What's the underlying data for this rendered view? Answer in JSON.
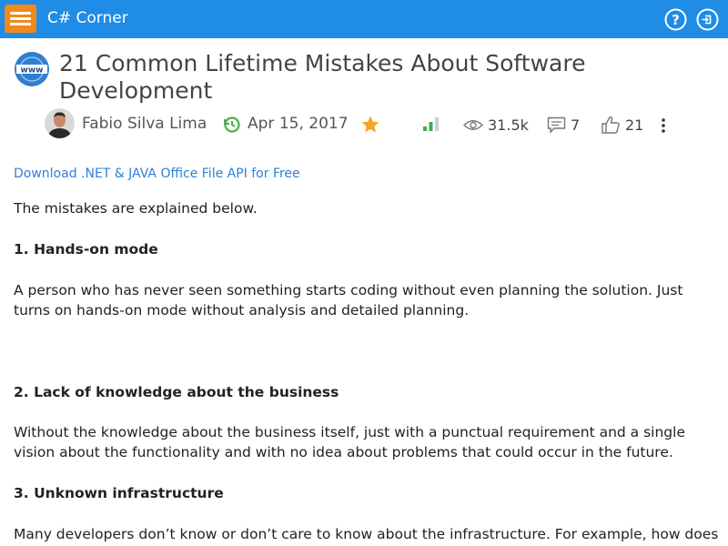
{
  "header": {
    "brand": "C# Corner",
    "menu_icon": "hamburger-menu-icon",
    "help_icon": "help-icon",
    "login_icon": "login-icon",
    "bar_color": "#1f8ce6",
    "menu_color": "#f08a1c"
  },
  "article": {
    "title": "21 Common Lifetime Mistakes About Software Development",
    "author": "Fabio Silva Lima",
    "date": "Apr 15, 2017",
    "views": "31.5k",
    "comments": "7",
    "likes": "21"
  },
  "promo_link": "Download .NET & JAVA Office File API for Free",
  "content": {
    "intro": "The mistakes are explained below.",
    "h1": "1. Hands-on mode",
    "p1": "A person who has never seen something starts coding without even planning the solution. Just turns on hands-on mode without analysis and detailed planning.",
    "h2": "2. Lack of knowledge about the business",
    "p2": "Without the knowledge about the business itself, just with a punctual requirement and a single vision about the functionality and with no idea about problems that could occur in the future.",
    "h3": "3. Unknown infrastructure",
    "p3": "Many developers don’t know or don’t care to know about the infrastructure. For example, how does"
  }
}
